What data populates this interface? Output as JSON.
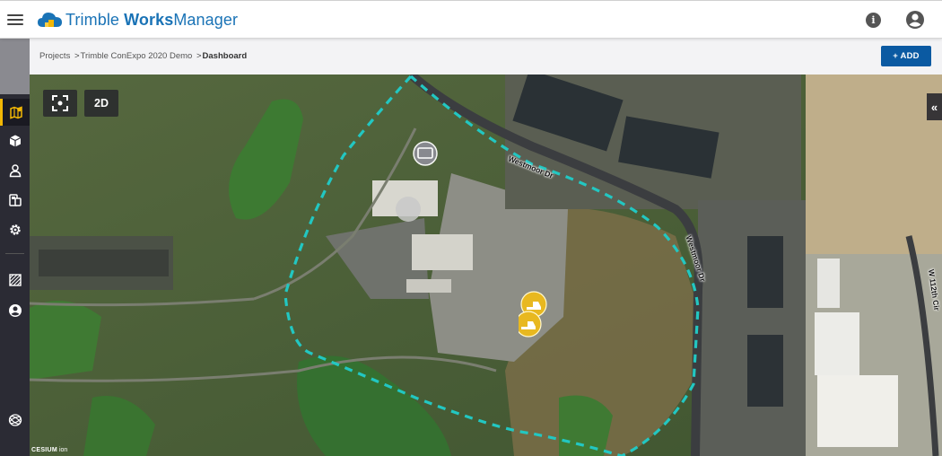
{
  "app": {
    "brand_light": "Trimble ",
    "brand_bold": "Works",
    "brand_suffix": "Manager"
  },
  "icons": {
    "menu": "hamburger-icon",
    "info": "info-icon",
    "account": "account-circle-icon"
  },
  "sidebar": {
    "items": [
      {
        "name": "map",
        "icon": "map-pin-icon",
        "active": true
      },
      {
        "name": "models",
        "icon": "cube-icon",
        "active": false
      },
      {
        "name": "users",
        "icon": "person-icon",
        "active": false
      },
      {
        "name": "devices",
        "icon": "devices-icon",
        "active": false
      },
      {
        "name": "settings",
        "icon": "gear-icon",
        "active": false
      },
      {
        "name": "reports",
        "icon": "hatch-grid-icon",
        "active": false
      },
      {
        "name": "profile",
        "icon": "user-circle-icon",
        "active": false
      },
      {
        "name": "trimble",
        "icon": "trimble-globe-icon",
        "active": false
      }
    ]
  },
  "breadcrumb": {
    "items": [
      "Projects",
      "Trimble ConExpo 2020 Demo"
    ],
    "current": "Dashboard"
  },
  "toolbar": {
    "add_label": "+ ADD"
  },
  "map": {
    "view_mode_label": "2D",
    "collapse_label": "«",
    "road_labels": [
      "Westmoor Dr",
      "Westmoor Dr",
      "W 112th Cir"
    ],
    "attribution_brand": "CESIUM",
    "attribution_suffix": "ion",
    "accent_color": "#22c7c2",
    "pin_color": "#e8b820"
  }
}
